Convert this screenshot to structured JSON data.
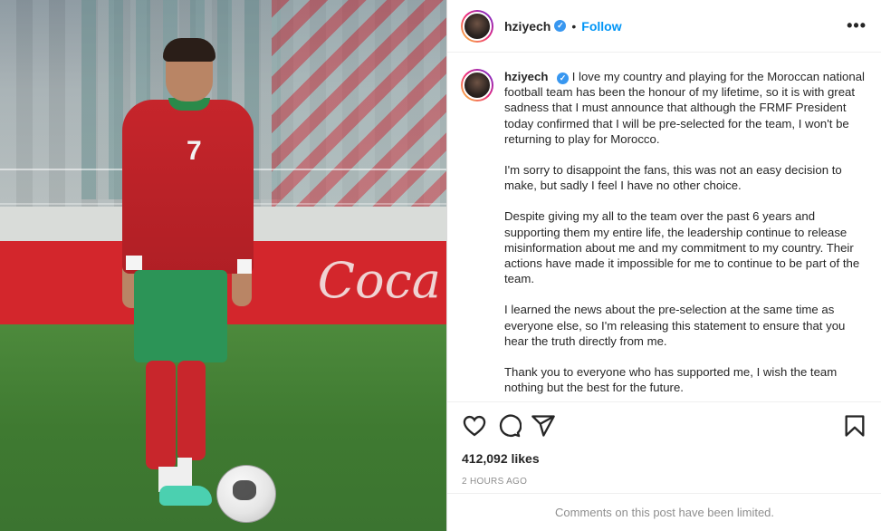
{
  "post": {
    "username": "hziyech",
    "verified_glyph": "✓",
    "separator": "•",
    "follow_label": "Follow",
    "more_glyph": "•••",
    "caption_paragraphs": [
      "I love my country and playing for the Moroccan national football team has been the honour of my lifetime, so it is with great sadness that I must announce that although the FRMF President today confirmed that I will be pre-selected for the team, I won't be returning to play for Morocco.",
      "I'm sorry to disappoint the fans, this was not an easy decision to make, but sadly I feel I have no other choice.",
      "Despite giving my all to the team over the past 6 years and supporting them my entire life, the leadership continue to release misinformation about me and my commitment to my country. Their actions have made it impossible for me to continue to be part of the team.",
      "I learned the news about the pre-selection at the same time as everyone else, so I'm releasing this statement to ensure that you hear the truth directly from me.",
      "Thank you to everyone who has supported me, I wish the team nothing but the best for the future."
    ],
    "likes": "412,092 likes",
    "timestamp": "2 HOURS AGO",
    "comments_limited": "Comments on this post have been limited.",
    "photo": {
      "jersey_number": "7",
      "board_logo": "Coca"
    }
  },
  "icons": [
    "heart-icon",
    "comment-icon",
    "share-icon",
    "bookmark-icon",
    "verified-icon",
    "more-options-icon"
  ],
  "colors": {
    "accent": "#0095f6",
    "verified": "#3897f0",
    "muted": "#8e8e8e",
    "text": "#262626"
  }
}
